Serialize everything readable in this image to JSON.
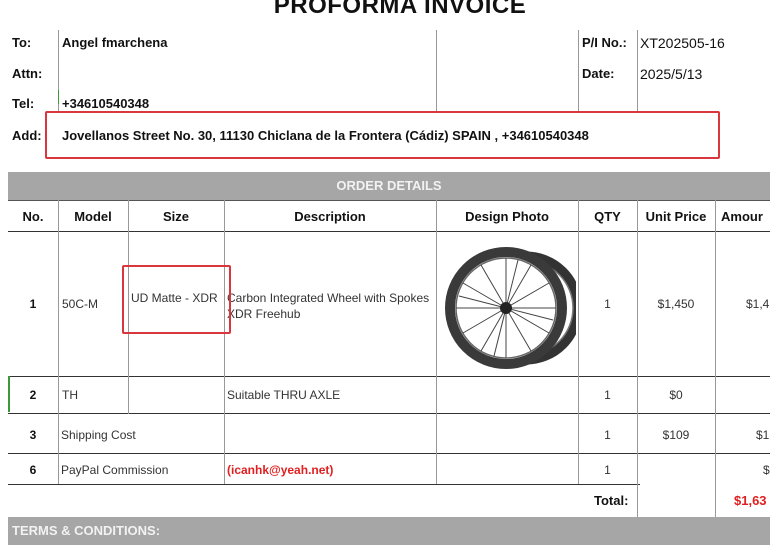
{
  "title": "PROFORMA INVOICE",
  "header": {
    "to_label": "To:",
    "to_value": "Angel fmarchena",
    "attn_label": "Attn:",
    "attn_value": "",
    "tel_label": "Tel:",
    "tel_value": "+34610540348",
    "add_label": "Add:",
    "add_value": "Jovellanos Street No. 30, 11130 Chiclana de la Frontera (Cádiz) SPAIN  , +34610540348",
    "pi_label": "P/I No.:",
    "pi_value": "XT202505-16",
    "date_label": "Date:",
    "date_value": "2025/5/13"
  },
  "order_details_title": "ORDER DETAILS",
  "columns": [
    "No.",
    "Model",
    "Size",
    "Description",
    "Design Photo",
    "QTY",
    "Unit Price",
    "Amour"
  ],
  "rows": [
    {
      "no": "1",
      "model": "50C-M",
      "size": "UD Matte - XDR",
      "description": "Carbon Integrated Wheel with Spokes  XDR Freehub",
      "qty": "1",
      "unit_price": "$1,450",
      "amount": "$1,4"
    },
    {
      "no": "2",
      "model": "TH",
      "size": "",
      "description": "Suitable THRU AXLE",
      "qty": "1",
      "unit_price": "$0",
      "amount": ""
    },
    {
      "no": "3",
      "model": "Shipping Cost",
      "size": "",
      "description": "",
      "qty": "1",
      "unit_price": "$109",
      "amount": "$1"
    },
    {
      "no": "6",
      "model": "PayPal Commission",
      "size": "",
      "description": "(icanhk@yeah.net)",
      "qty": "1",
      "unit_price": "",
      "amount": "$"
    }
  ],
  "total_label": "Total:",
  "total_value": "$1,63",
  "terms_title": "TERMS & CONDITIONS:",
  "colors": {
    "annotation_red": "#d9363e",
    "section_gray": "#a6a6a6",
    "value_red": "#e02020"
  }
}
